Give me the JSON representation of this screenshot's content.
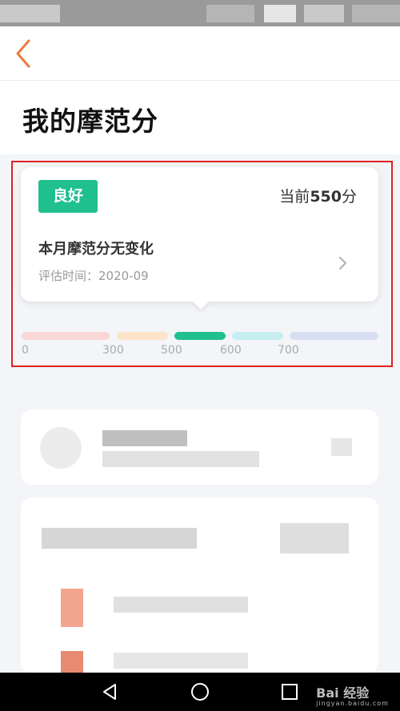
{
  "page": {
    "title": "我的摩范分"
  },
  "score_card": {
    "badge": "良好",
    "current_prefix": "当前",
    "current_score": "550",
    "current_suffix": "分",
    "change_text": "本月摩范分无变化",
    "eval_label": "评估时间：",
    "eval_date": "2020-09"
  },
  "score_scale": {
    "current_value": 550,
    "ticks": [
      "0",
      "300",
      "500",
      "600",
      "700"
    ],
    "segments": [
      {
        "color": "#f9d7d7"
      },
      {
        "color": "#fde3c8"
      },
      {
        "color": "#1fc08e"
      },
      {
        "color": "#c7eef0"
      },
      {
        "color": "#d8dff3"
      }
    ]
  },
  "watermark": {
    "text": "Bai 经验",
    "sub": "jingyan.baidu.com"
  },
  "colors": {
    "accent": "#1fc08e",
    "back_arrow": "#f07a3c",
    "highlight": "#e02020"
  },
  "icons": {
    "back": "chevron-left-icon",
    "detail": "chevron-right-icon",
    "nav_back": "triangle-back-icon",
    "nav_home": "circle-home-icon",
    "nav_recent": "square-recent-icon"
  }
}
